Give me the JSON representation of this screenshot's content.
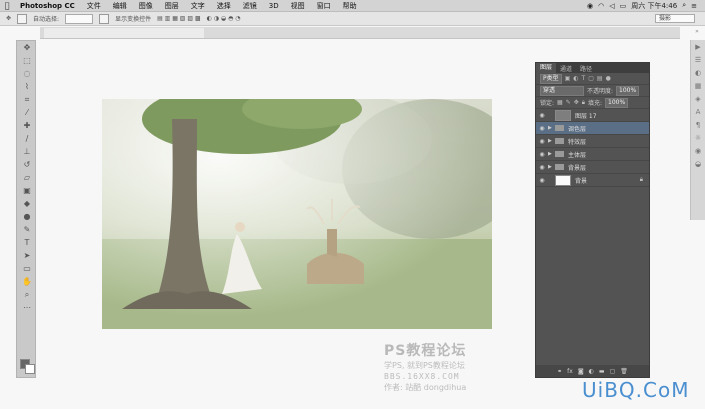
{
  "menubar": {
    "apple": "",
    "app": "Photoshop CC",
    "items": [
      "文件",
      "编辑",
      "图像",
      "图层",
      "文字",
      "选择",
      "滤镜",
      "3D",
      "视图",
      "窗口",
      "帮助"
    ],
    "clock": "周六 下午4:46"
  },
  "options": {
    "auto_select": "自动选择:",
    "show_transform": "显示变换控件",
    "workspace": "摄影"
  },
  "watermark": {
    "title": "PS教程论坛",
    "line1": "学PS, 就到PS教程论坛",
    "line2": "BBS.16XX8.COM",
    "line3": "作者: 站酷 dongdihua"
  },
  "panel": {
    "tabs": [
      "图层",
      "通道",
      "路径"
    ],
    "filter": "P类型",
    "blend_mode": "穿透",
    "opacity_label": "不透明度:",
    "opacity_value": "100%",
    "lock_label": "锁定:",
    "fill_label": "填充:",
    "fill_value": "100%",
    "layers": [
      {
        "name": "图层 17",
        "type": "layer",
        "selected": false
      },
      {
        "name": "调色层",
        "type": "group",
        "selected": true
      },
      {
        "name": "特效层",
        "type": "group",
        "selected": false
      },
      {
        "name": "主体层",
        "type": "group",
        "selected": false
      },
      {
        "name": "背景层",
        "type": "group",
        "selected": false
      },
      {
        "name": "背景",
        "type": "background",
        "selected": false
      }
    ],
    "bottom_icons": [
      "link-icon",
      "fx-icon",
      "mask-icon",
      "adjustment-icon",
      "folder-icon",
      "new-layer-icon",
      "trash-icon"
    ]
  },
  "logo": {
    "text": "UiBQ.CoM"
  }
}
